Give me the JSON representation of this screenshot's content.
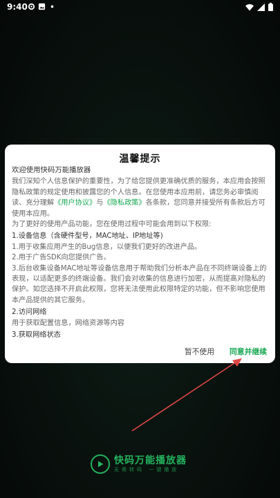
{
  "status_bar": {
    "time": "9:40",
    "left_icons": [
      "settings-gear-icon",
      "gallery-icon",
      "dot-icon"
    ],
    "right_icons": [
      "wifi-icon",
      "signal-icon",
      "battery-icon"
    ]
  },
  "dialog": {
    "title": "温馨提示",
    "welcome": "欢迎使用快码万能播放器",
    "intro_pre": "我们深知个人信息保护的重要性，为了给您提供更准确优质的服务，本应用会按照隐私政策的规定使用和披露您的个人信息。在您使用本应用前，请您务必审慎阅读、充分理解",
    "user_agreement_link": "《用户协议》",
    "and_text": "与",
    "privacy_policy_link": "《隐私政策》",
    "intro_post": "各条款，您同意并接受所有条款后方可使用本应用。",
    "purpose": "为了更好的使用产品功能，您在使用过程中可能会用到以下权限:",
    "section1_title": "1.设备信息（含硬件型号，MAC地址、IP地址等)",
    "section1_item1": "1.用于收集应用产生的Bug信息，以便我们更好的改进产品。",
    "section1_item2": "2.用于广告SDK向您提供广告。",
    "section1_item3": "3.后台收集设备MAC地址等设备信息用于帮助我们分析本产品在不同终端设备上的表现，以适配更多的终端设备。我们会对收集的信息进行加密，从而提高对隐私的保护。如您选择不开启此权限，您将无法使用此权限特定的功能，但不影响您使用本产品提供的其它服务。",
    "section2_title": "2.访问网络",
    "section2_item": "用于获取配置信息，网络资源等内容",
    "section3_title": "3.获取网络状态",
    "decline_label": "暂不使用",
    "accept_label": "同意并继续"
  },
  "brand": {
    "name": "快码万能播放器",
    "slogan": "无需转码 一键播放",
    "logo_icon": "play-icon"
  },
  "colors": {
    "accent": "#17a852",
    "annotation_arrow": "#e04848"
  }
}
